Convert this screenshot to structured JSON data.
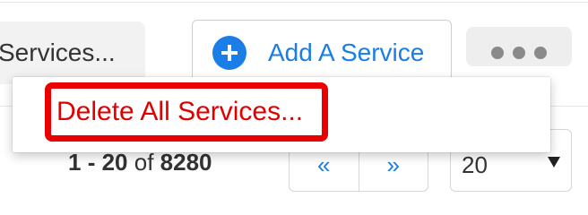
{
  "toolbar": {
    "services_label": "Services...",
    "add_service_label": "Add A Service",
    "more_icon": "ellipsis-icon"
  },
  "menu": {
    "items": [
      {
        "label": "Delete All Services..."
      }
    ]
  },
  "pagination": {
    "range_start": "1",
    "range_end": "20",
    "range_sep": " - ",
    "of_label": "of",
    "total": "8280",
    "prev_label": "«",
    "next_label": "»",
    "page_size": "20"
  },
  "colors": {
    "accent": "#1a7ee6",
    "danger": "#e00000",
    "highlight_border": "#ea0000"
  }
}
